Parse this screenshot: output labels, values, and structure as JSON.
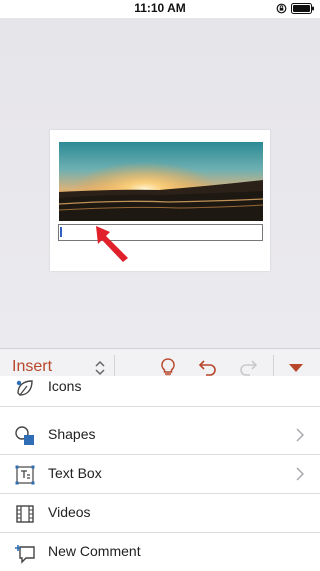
{
  "status_bar": {
    "time": "11:10 AM"
  },
  "ribbon": {
    "tab_name": "Insert"
  },
  "commands": [
    {
      "label": "Icons"
    },
    {
      "label": "Shapes"
    },
    {
      "label": "Text Box"
    },
    {
      "label": "Videos"
    },
    {
      "label": "New Comment"
    }
  ],
  "colors": {
    "accent": "#b7472a",
    "annotation_arrow": "#e0202a"
  },
  "icons": {
    "status": [
      "rotation-lock-icon",
      "battery-icon"
    ],
    "ribbon": [
      "chevron-updown-icon",
      "lightbulb-icon",
      "undo-icon",
      "redo-icon",
      "collapse-ribbon-icon"
    ],
    "commands": [
      "icons-icon",
      "shapes-icon",
      "text-box-icon",
      "videos-icon",
      "new-comment-icon"
    ]
  }
}
